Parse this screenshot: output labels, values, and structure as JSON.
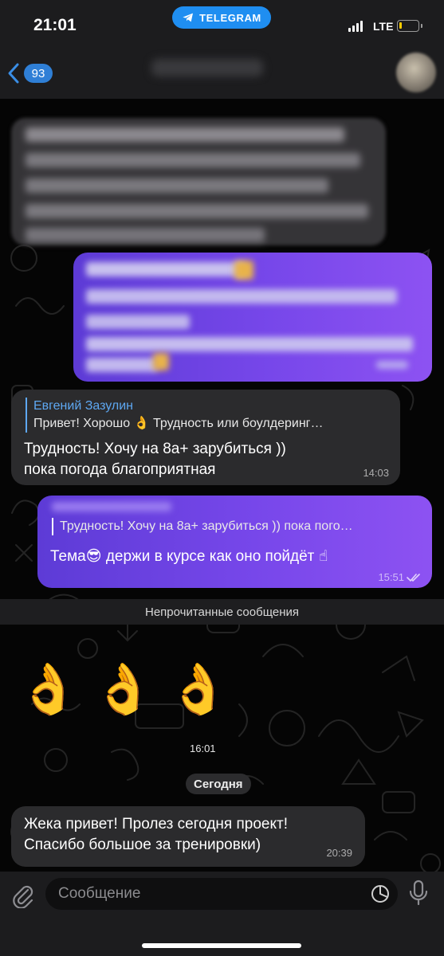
{
  "status_bar": {
    "time": "21:01",
    "app_pill": "TELEGRAM",
    "network": "LTE",
    "battery_level": 0.15
  },
  "nav": {
    "unread_count": "93"
  },
  "messages": {
    "m3": {
      "reply_author": "Евгений Зазулин",
      "reply_snippet": "Привет! Хорошо 👌 Трудность или боулдеринг…",
      "line1": "Трудность! Хочу на 8а+ зарубиться ))",
      "line2": "пока погода благоприятная",
      "time": "14:03"
    },
    "m4": {
      "reply_snippet": "Трудность! Хочу на 8а+ зарубиться )) пока пого…",
      "text": "Тема😎 держи в курсе как оно пойдёт ☝",
      "time": "15:51"
    }
  },
  "unread_banner": "Непрочитанные сообщения",
  "sticker": {
    "glyph": "👌",
    "time": "16:01"
  },
  "date_separator": "Сегодня",
  "last_message": {
    "line1": "Жека привет! Пролез сегодня проект!",
    "line2": "Спасибо большое за тренировки)",
    "time": "20:39"
  },
  "composer": {
    "placeholder": "Сообщение"
  },
  "colors": {
    "incoming_bubble": "#2b2b2d",
    "outgoing_bubble_start": "#5d3bd6",
    "outgoing_bubble_end": "#8d52f2",
    "accent_blue": "#2f7fd6",
    "reply_name": "#5ea8f2"
  },
  "icons": [
    "telegram-plane-icon",
    "back-chevron-icon",
    "signal-icon",
    "battery-icon",
    "read-checkmarks-icon",
    "paperclip-icon",
    "sticker-icon",
    "microphone-icon"
  ]
}
